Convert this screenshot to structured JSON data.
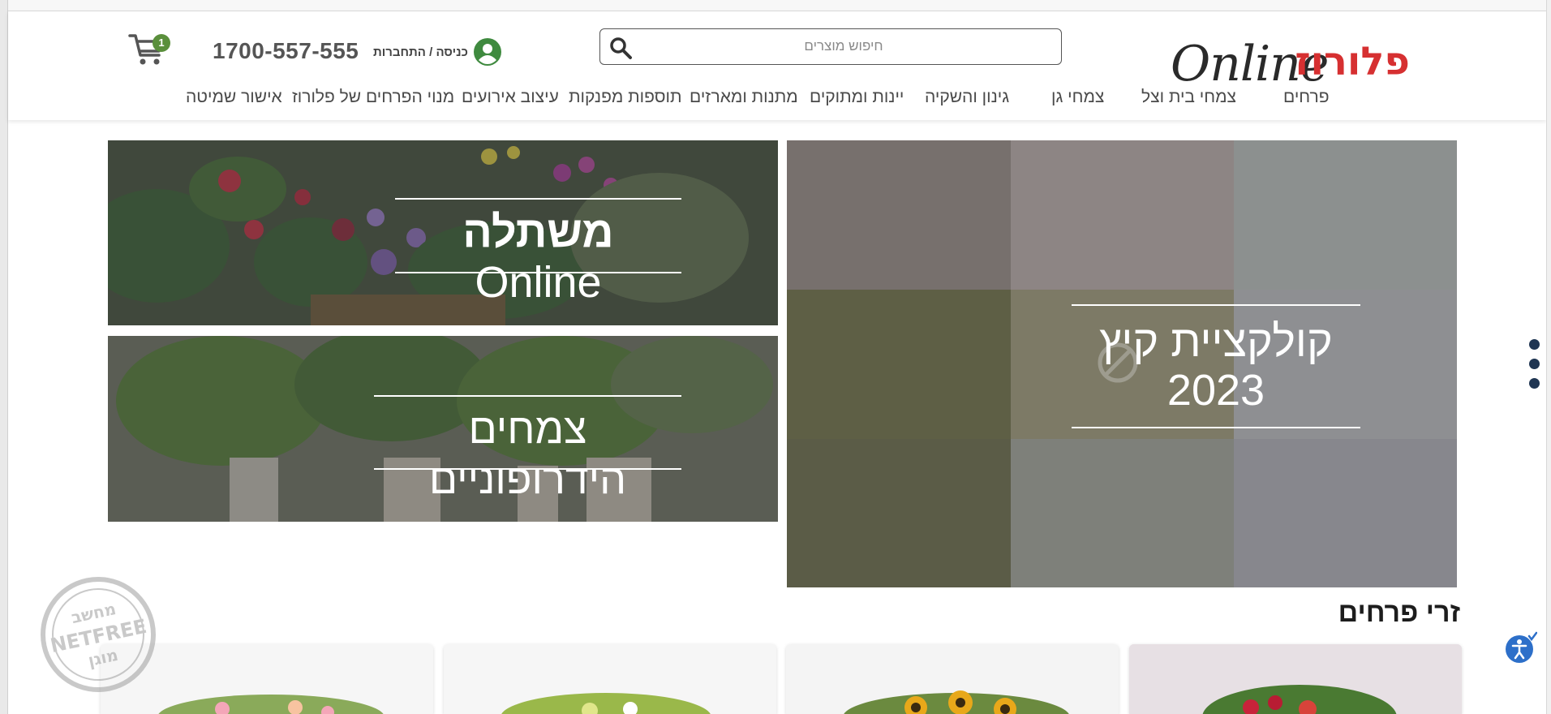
{
  "header": {
    "logo": {
      "script_text": "Online",
      "hebrew_text": "פלורוז"
    },
    "search": {
      "placeholder": "חיפוש מוצרים",
      "value": ""
    },
    "login_label": "כניסה / התחברות",
    "phone": "1700-557-555",
    "cart_count": "1"
  },
  "nav": {
    "items": [
      {
        "label": "פרחים"
      },
      {
        "label": "צמחי בית וצל"
      },
      {
        "label": "צמחי גן"
      },
      {
        "label": "גינון והשקיה"
      },
      {
        "label": "יינות ומתוקים"
      },
      {
        "label": "מתנות ומארזים"
      },
      {
        "label": "תוספות מפנקות"
      },
      {
        "label": "עיצוב אירועים"
      },
      {
        "label": "מנוי הפרחים של פלורוז"
      },
      {
        "label": "אישור שמיטה"
      }
    ]
  },
  "banners": {
    "main": {
      "line1": "קולקציית קיץ",
      "line2": "2023"
    },
    "top": {
      "bold": "משתלה",
      "light": "Online"
    },
    "bottom": {
      "text": "צמחים הידרופוניים"
    }
  },
  "section": {
    "title": "זרי פרחים"
  },
  "stamp": {
    "top": "מחשב",
    "middle": "NETFREE",
    "bottom": "מוגן"
  },
  "colors": {
    "brand_green": "#3a8a3a",
    "brand_red": "#d63031",
    "cart_badge": "#5a8f3c",
    "user_icon": "#3f8a3f",
    "dots": "#1f3552",
    "a11y": "#2d6fc9"
  }
}
